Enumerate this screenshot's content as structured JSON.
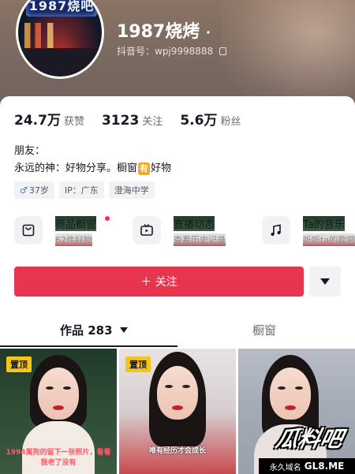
{
  "profile": {
    "avatar_sign": "1987烧吧",
    "nickname": "1987烧烤",
    "nickname_suffix": "·",
    "douyin_id": "抖音号：wpj9998888"
  },
  "stats": [
    {
      "value": "24.7万",
      "label": "获赞"
    },
    {
      "value": "3123",
      "label": "关注"
    },
    {
      "value": "5.6万",
      "label": "粉丝"
    }
  ],
  "bio": {
    "line1": "朋友：",
    "line2_prefix": "永远的神：好物分享。橱窗",
    "line2_badge": "有",
    "line2_suffix": "好物"
  },
  "tags": {
    "gender_symbol": "♂",
    "age": "37岁",
    "location": "IP：广东",
    "school": "澄海中学"
  },
  "features": [
    {
      "title": "商品橱窗",
      "subtitle": "62件好物",
      "icon": "shopping-bag-icon",
      "has_dot": true
    },
    {
      "title": "直播动态",
      "subtitle": "查看历史记录",
      "icon": "tv-icon"
    },
    {
      "title": "Ta的音乐",
      "subtitle": "听听ta的歌吧",
      "icon": "music-note-icon"
    }
  ],
  "actions": {
    "follow_label": "＋ 关注",
    "dropdown_icon": "triangle-down-icon"
  },
  "tabs": {
    "works_label": "作品 283",
    "window_label": "橱窗"
  },
  "videos": [
    {
      "pinned": "置顶",
      "caption": "1994属狗的留下一张照片，看看我老了没有"
    },
    {
      "pinned": "置顶",
      "caption": "唯有经历才会成长"
    },
    {
      "caption": ""
    }
  ],
  "watermark": {
    "logo": "瓜料吧",
    "bar_text": "永久域名",
    "domain": "GL8.ME"
  },
  "colors": {
    "follow_button": "#e8354f",
    "pin_badge": "#f5c518",
    "accent_red": "#fe2c55"
  }
}
